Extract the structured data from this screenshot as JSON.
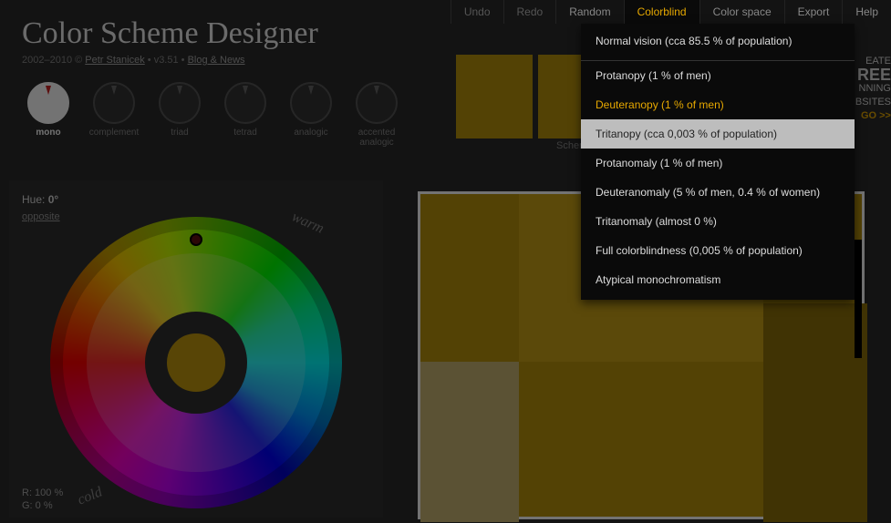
{
  "header": {
    "title": "Color Scheme Designer",
    "years": "2002–2010 ©",
    "author": "Petr Stanicek",
    "version": "v3.51",
    "blog_link": "Blog & News"
  },
  "topmenu": {
    "undo": "Undo",
    "redo": "Redo",
    "random": "Random",
    "colorblind": "Colorblind",
    "colorspace": "Color space",
    "export": "Export",
    "help": "Help"
  },
  "colorblind_menu": {
    "normal": "Normal vision (cca 85.5 % of population)",
    "protanopy": "Protanopy (1 % of men)",
    "deuteranopy": "Deuteranopy (1 % of men)",
    "tritanopy": "Tritanopy (cca 0,003 % of population)",
    "protanomaly": "Protanomaly (1 % of men)",
    "deuteranomaly": "Deuteranomaly (5 % of men, 0.4 % of women)",
    "tritanomaly": "Tritanomaly (almost 0 %)",
    "full": "Full colorblindness (0,005 % of population)",
    "atypical": "Atypical monochromatism"
  },
  "schemes": {
    "mono": "mono",
    "complement": "complement",
    "triad": "triad",
    "tetrad": "tetrad",
    "analogic": "analogic",
    "accented": "accented analogic"
  },
  "hue": {
    "label": "Hue:",
    "value": "0°",
    "opposite": "opposite"
  },
  "wheel": {
    "warm": "warm",
    "cold": "cold"
  },
  "rgb": {
    "r": "R: 100 %",
    "g": "G:    0 %"
  },
  "scheme_id_label": "Schem",
  "promo": {
    "l1": "EATE",
    "l2": "REE",
    "l3": "NNING",
    "l4": "BSITES",
    "go": "GO >>"
  },
  "swatches": {
    "c1": "#b8930d",
    "c2": "#b8930d"
  },
  "preview_colors": {
    "base": "#b8930d",
    "light": "#caa318",
    "pale": "#c9b574",
    "dark": "#8f720a"
  }
}
